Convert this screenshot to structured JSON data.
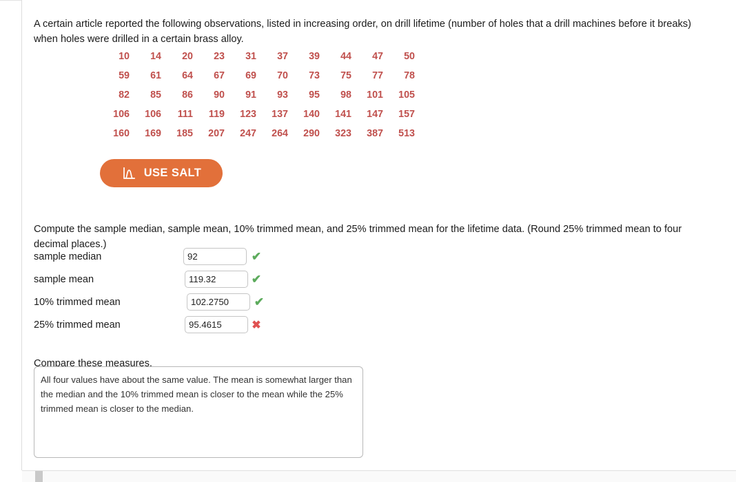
{
  "question": {
    "intro": "A certain article reported the following observations, listed in increasing order, on drill lifetime (number of holes that a drill machines before it breaks) when holes were drilled in a certain brass alloy.",
    "prompt": "Compute the sample median, sample mean, 10% trimmed mean, and 25% trimmed mean for the lifetime data. (Round 25% trimmed mean to four decimal places.)",
    "compare_heading": "Compare these measures."
  },
  "data_values": [
    [
      "10",
      "14",
      "20",
      "23",
      "31",
      "37",
      "39",
      "44",
      "47",
      "50"
    ],
    [
      "59",
      "61",
      "64",
      "67",
      "69",
      "70",
      "73",
      "75",
      "77",
      "78"
    ],
    [
      "82",
      "85",
      "86",
      "90",
      "91",
      "93",
      "95",
      "98",
      "101",
      "105"
    ],
    [
      "106",
      "106",
      "111",
      "119",
      "123",
      "137",
      "140",
      "141",
      "147",
      "157"
    ],
    [
      "160",
      "169",
      "185",
      "207",
      "247",
      "264",
      "290",
      "323",
      "387",
      "513"
    ]
  ],
  "salt_button": {
    "label": "USE SALT",
    "icon": "distribution-curve-icon",
    "color": "#e2703a"
  },
  "answers": [
    {
      "label": "sample median",
      "value": "92",
      "status": "correct",
      "mark": "✔"
    },
    {
      "label": "sample mean",
      "value": "119.32",
      "status": "correct",
      "mark": "✔"
    },
    {
      "label": "10% trimmed mean",
      "value": "102.2750",
      "status": "correct",
      "mark": "✔"
    },
    {
      "label": "25% trimmed mean",
      "value": "95.4615",
      "status": "incorrect",
      "mark": "✖"
    }
  ],
  "compare_answer": "All four values have about the same value. The mean is somewhat larger than the median and the 10% trimmed mean is closer to the mean while the 25% trimmed mean is closer to the median.",
  "colors": {
    "data_text": "#c0504d",
    "correct": "#5cab5c",
    "incorrect": "#e05252",
    "accent": "#e2703a"
  }
}
